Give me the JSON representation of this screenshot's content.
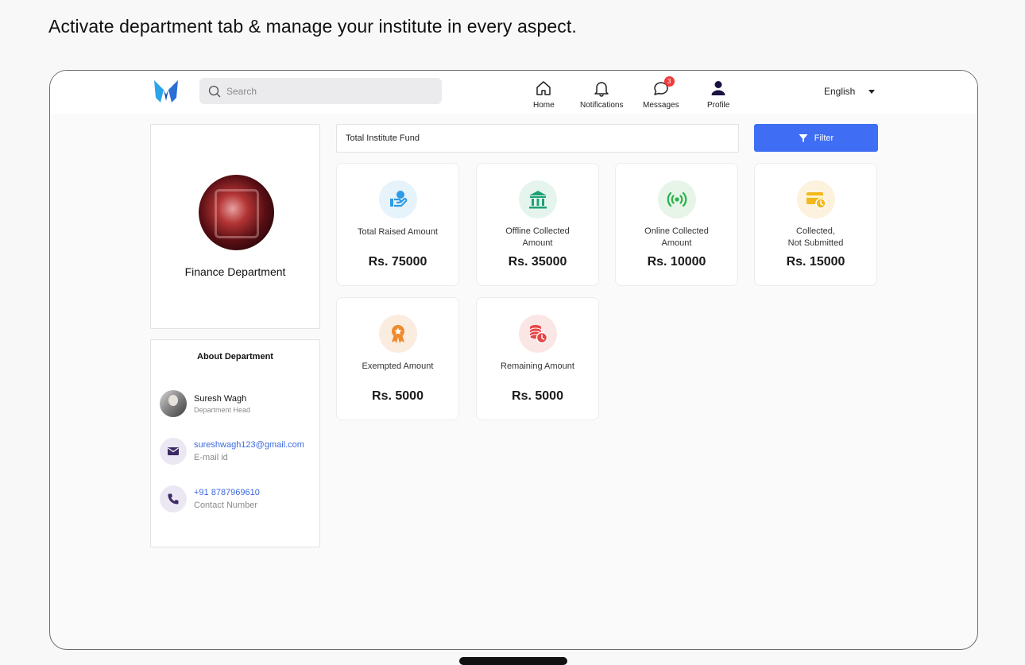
{
  "headline": "Activate department tab & manage your institute in every aspect.",
  "topbar": {
    "search_placeholder": "Search",
    "nav": [
      {
        "label": "Home",
        "icon": "home-icon"
      },
      {
        "label": "Notifications",
        "icon": "bell-icon"
      },
      {
        "label": "Messages",
        "icon": "chat-icon",
        "badge": "3"
      },
      {
        "label": "Profile",
        "icon": "user-icon"
      }
    ],
    "language": "English"
  },
  "department": {
    "name": "Finance Department"
  },
  "about": {
    "title": "About Department",
    "head_name": "Suresh Wagh",
    "head_role": "Department Head",
    "email": "sureshwagh123@gmail.com",
    "email_label": "E-mail id",
    "phone": "+91 8787969610",
    "phone_label": "Contact Number"
  },
  "main": {
    "fund_select": "Total Institute Fund",
    "filter_label": "Filter",
    "stats": [
      {
        "label_line1": "Total Raised Amount",
        "label_line2": "",
        "value": "Rs. 75000",
        "icon": "hand-coin-icon",
        "color": "#2f9be6",
        "bg": "#e6f3fb"
      },
      {
        "label_line1": "Offline Collected",
        "label_line2": "Amount",
        "value": "Rs. 35000",
        "icon": "bank-icon",
        "color": "#1fa176",
        "bg": "#e5f5ee"
      },
      {
        "label_line1": "Online Collected",
        "label_line2": "Amount",
        "value": "Rs. 10000",
        "icon": "signal-icon",
        "color": "#27b34a",
        "bg": "#e6f5e8"
      },
      {
        "label_line1": "Collected,",
        "label_line2": "Not Submitted",
        "value": "Rs. 15000",
        "icon": "card-clock-icon",
        "color": "#f2b81c",
        "bg": "#fcf2de"
      },
      {
        "label_line1": "Exempted Amount",
        "label_line2": "",
        "value": "Rs. 5000",
        "icon": "award-icon",
        "color": "#f08a2e",
        "bg": "#fbece0"
      },
      {
        "label_line1": "Remaining Amount",
        "label_line2": "",
        "value": "Rs. 5000",
        "icon": "coins-clock-icon",
        "color": "#e84545",
        "bg": "#fbe6e6"
      }
    ]
  }
}
